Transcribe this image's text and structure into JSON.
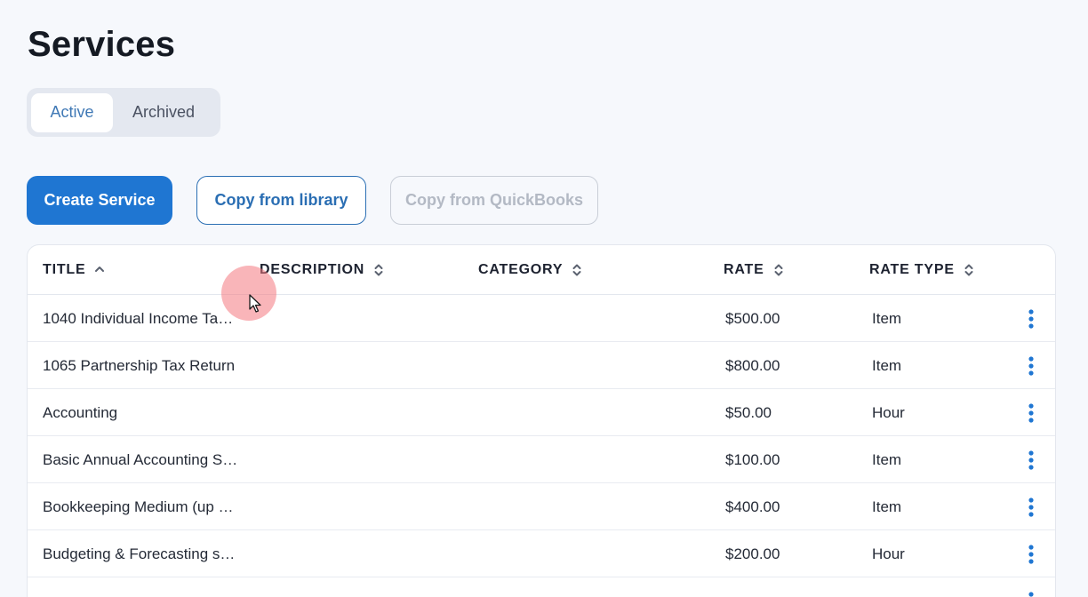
{
  "page": {
    "title": "Services"
  },
  "tabs": {
    "active_label": "Active",
    "archived_label": "Archived",
    "selected": "Active"
  },
  "actions": {
    "create_label": "Create Service",
    "copy_library_label": "Copy from library",
    "copy_quickbooks_label": "Copy from QuickBooks"
  },
  "table": {
    "columns": {
      "title": "TITLE",
      "description": "DESCRIPTION",
      "category": "CATEGORY",
      "rate": "RATE",
      "rate_type": "RATE TYPE"
    },
    "sort": {
      "column": "TITLE",
      "direction": "ascending"
    },
    "rows": [
      {
        "title": "1040 Individual Income Ta…",
        "description": "",
        "category": "",
        "rate": "$500.00",
        "rate_type": "Item"
      },
      {
        "title": "1065 Partnership Tax Return",
        "description": "",
        "category": "",
        "rate": "$800.00",
        "rate_type": "Item"
      },
      {
        "title": "Accounting",
        "description": "",
        "category": "",
        "rate": "$50.00",
        "rate_type": "Hour"
      },
      {
        "title": "Basic Annual Accounting S…",
        "description": "",
        "category": "",
        "rate": "$100.00",
        "rate_type": "Item"
      },
      {
        "title": "Bookkeeping Medium (up …",
        "description": "",
        "category": "",
        "rate": "$400.00",
        "rate_type": "Item"
      },
      {
        "title": "Budgeting & Forecasting s…",
        "description": "",
        "category": "",
        "rate": "$200.00",
        "rate_type": "Hour"
      }
    ]
  },
  "colors": {
    "primary": "#1f76d2",
    "accent_text": "#3f78b5",
    "page_background": "#f6f8fc",
    "disabled_text": "#b3b9c4",
    "cursor_highlight": "#f47880"
  },
  "icons": {
    "sort_ascending": "chevron-up-icon",
    "sortable": "sort-icon",
    "row_menu": "more-vertical-icon",
    "cursor": "mouse-pointer-icon"
  }
}
